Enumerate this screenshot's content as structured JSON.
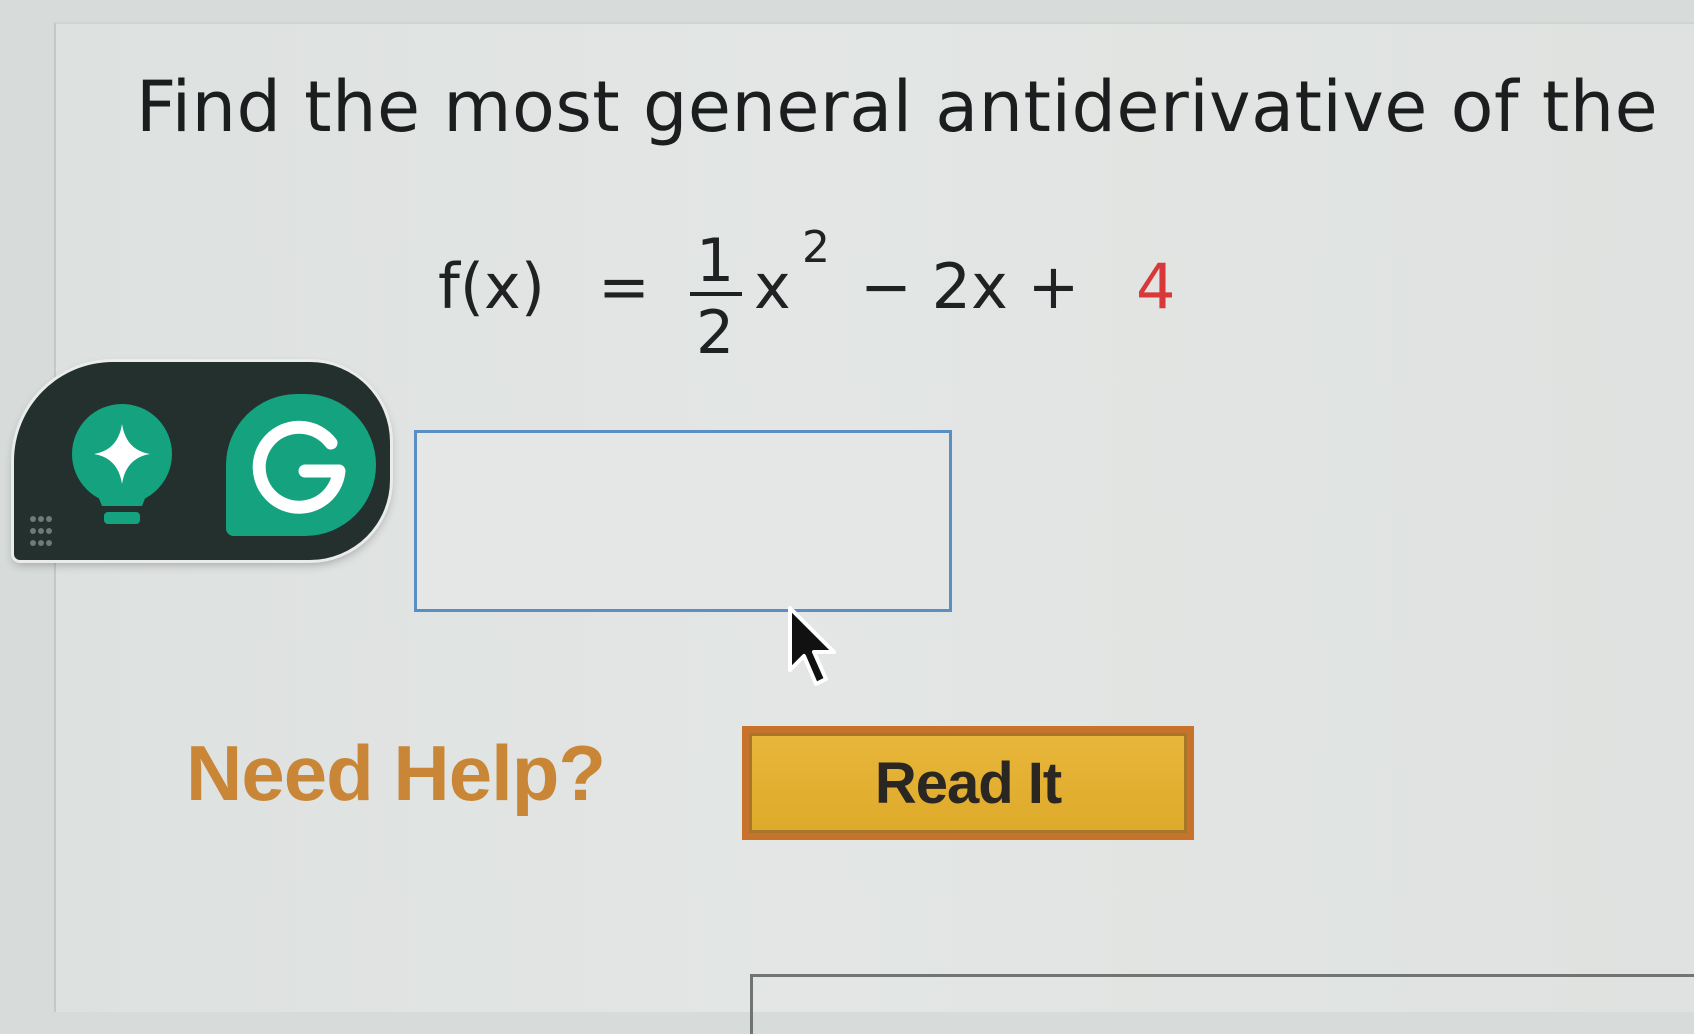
{
  "question": {
    "text": "Find the most general antiderivative of the"
  },
  "equation": {
    "lhs": "f(x)",
    "equals": "=",
    "fraction_numerator": "1",
    "fraction_denominator": "2",
    "variable": "x",
    "exponent": "2",
    "middle": "−  2x  +",
    "constant": "4",
    "constant_color": "#d8383a"
  },
  "answer": {
    "value": "",
    "placeholder": ""
  },
  "help": {
    "label": "Need Help?",
    "read_it_label": "Read It"
  },
  "overlay_widget": {
    "icons": [
      "lightbulb-sparkle-icon",
      "grammarly-icon",
      "drag-handle-icon"
    ],
    "accent_color": "#15a37f"
  },
  "colors": {
    "help_text": "#c98637",
    "button_fill": "#e8b63a",
    "button_border": "#c8732c",
    "input_border": "#5b8fc4"
  }
}
